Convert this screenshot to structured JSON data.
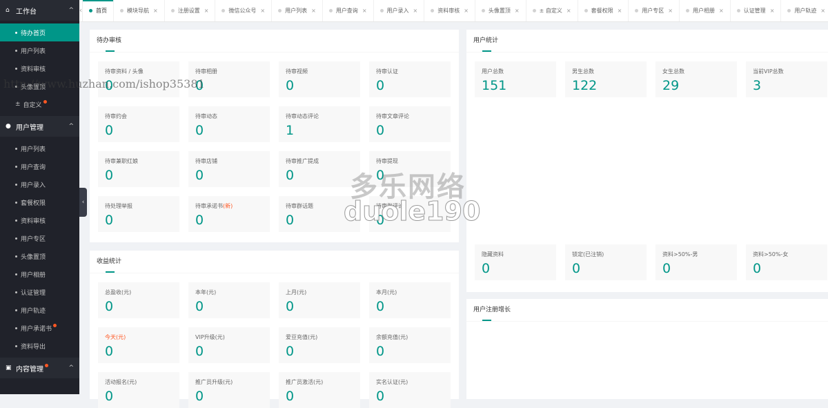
{
  "sidebar": {
    "group1": {
      "label": "工作台",
      "chevron": "^"
    },
    "g1items": [
      {
        "label": "待办首页",
        "active": true,
        "badge": false
      },
      {
        "label": "用户列表",
        "active": false,
        "badge": false
      },
      {
        "label": "资料审核",
        "active": false,
        "badge": false
      },
      {
        "label": "头像置顶",
        "active": false,
        "badge": false
      },
      {
        "label": "自定义",
        "active": false,
        "badge": true,
        "plus": "±"
      }
    ],
    "group2": {
      "label": "用户管理",
      "chevron": "^"
    },
    "g2items": [
      {
        "label": "用户列表",
        "badge": false
      },
      {
        "label": "用户查询",
        "badge": false
      },
      {
        "label": "用户录入",
        "badge": false
      },
      {
        "label": "套餐权限",
        "badge": false
      },
      {
        "label": "资料审核",
        "badge": false
      },
      {
        "label": "用户专区",
        "badge": false
      },
      {
        "label": "头像置顶",
        "badge": false
      },
      {
        "label": "用户相册",
        "badge": false
      },
      {
        "label": "认证管理",
        "badge": false
      },
      {
        "label": "用户轨迹",
        "badge": false
      },
      {
        "label": "用户承诺书",
        "badge": true
      },
      {
        "label": "资料导出",
        "badge": false
      }
    ],
    "group3": {
      "label": "内容管理",
      "chevron": "^",
      "badge": true
    },
    "toggle": "‹"
  },
  "tabs": {
    "prev": "‹",
    "close": "×",
    "items": [
      {
        "label": "首页",
        "active": true,
        "closable": false
      },
      {
        "label": "模块导航",
        "closable": true
      },
      {
        "label": "注册设置",
        "closable": true
      },
      {
        "label": "微信公众号",
        "closable": true
      },
      {
        "label": "用户列表",
        "closable": true
      },
      {
        "label": "用户查询",
        "closable": true
      },
      {
        "label": "用户录入",
        "closable": true
      },
      {
        "label": "资料审核",
        "closable": true
      },
      {
        "label": "头像置顶",
        "closable": true
      },
      {
        "label": "± 自定义",
        "closable": true
      },
      {
        "label": "套餐权限",
        "closable": true
      },
      {
        "label": "用户专区",
        "closable": true
      },
      {
        "label": "用户相册",
        "closable": true
      },
      {
        "label": "认证管理",
        "closable": true
      },
      {
        "label": "用户轨迹",
        "closable": true
      }
    ]
  },
  "pending": {
    "title": "待办审核",
    "tiles": [
      {
        "label": "待审资料 / 头像",
        "value": "0"
      },
      {
        "label": "待审相册",
        "value": "0"
      },
      {
        "label": "待审视频",
        "value": "0"
      },
      {
        "label": "待审认证",
        "value": "0"
      },
      {
        "label": "待审约会",
        "value": "0"
      },
      {
        "label": "待审动态",
        "value": "0"
      },
      {
        "label": "待审动态评论",
        "value": "1"
      },
      {
        "label": "待审文章评论",
        "value": "0"
      },
      {
        "label": "待审兼职红娘",
        "value": "0"
      },
      {
        "label": "待审店铺",
        "value": "0"
      },
      {
        "label": "待审推广提成",
        "value": "0"
      },
      {
        "label": "待审提现",
        "value": "0"
      },
      {
        "label": "待处理举报",
        "value": "0"
      },
      {
        "label": "待审承诺书",
        "value": "0",
        "new": "(新)"
      },
      {
        "label": "待审群话题",
        "value": "0"
      },
      {
        "label": "待审群评论",
        "value": "0"
      }
    ]
  },
  "income": {
    "title": "收益统计",
    "tiles": [
      {
        "label": "总盈收(元)",
        "value": "0"
      },
      {
        "label": "本年(元)",
        "value": "0"
      },
      {
        "label": "上月(元)",
        "value": "0"
      },
      {
        "label": "本月(元)",
        "value": "0"
      },
      {
        "label": "今天(元)",
        "value": "0",
        "highlight": true
      },
      {
        "label": "VIP升级(元)",
        "value": "0"
      },
      {
        "label": "爱豆充值(元)",
        "value": "0"
      },
      {
        "label": "余额充值(元)",
        "value": "0"
      },
      {
        "label": "活动报名(元)",
        "value": "0"
      },
      {
        "label": "推广员升级(元)",
        "value": "0"
      },
      {
        "label": "推广员激活(元)",
        "value": "0"
      },
      {
        "label": "实名认证(元)",
        "value": "0"
      }
    ]
  },
  "users": {
    "title": "用户统计",
    "top": [
      {
        "label": "用户总数",
        "value": "151"
      },
      {
        "label": "男生总数",
        "value": "122"
      },
      {
        "label": "女生总数",
        "value": "29"
      },
      {
        "label": "当前VIP总数",
        "value": "3"
      }
    ],
    "bottom": [
      {
        "label": "隐藏资料",
        "value": "0"
      },
      {
        "label": "锁定(已注销)",
        "value": "0"
      },
      {
        "label": "资料>50%-男",
        "value": "0"
      },
      {
        "label": "资料>50%-女",
        "value": "0"
      }
    ]
  },
  "growth": {
    "title": "用户注册增长"
  },
  "watermark": {
    "url": "http://www.huzhan.com/ishop35381",
    "brand1": "多乐网络",
    "brand2": "duole190"
  },
  "colors": {
    "accent": "#009688",
    "sidebar": "#20222a",
    "badge": "#ff5722"
  }
}
